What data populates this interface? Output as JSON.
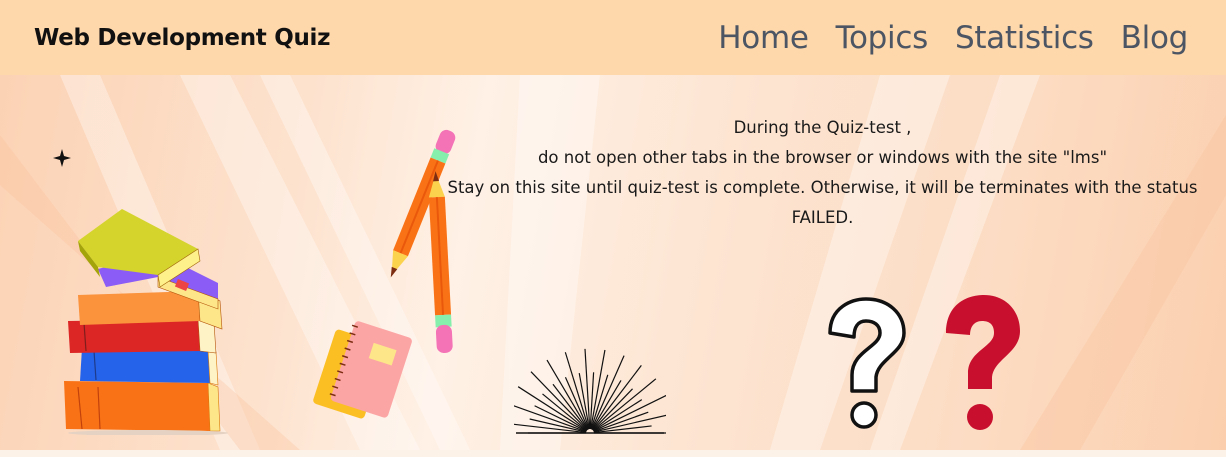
{
  "navbar": {
    "brand": "Web Development Quiz",
    "links": [
      {
        "label": "Home"
      },
      {
        "label": "Topics"
      },
      {
        "label": "Statistics"
      },
      {
        "label": "Blog"
      }
    ]
  },
  "notice": {
    "line1": "During the Quiz-test ,",
    "line2": "do not open other tabs in the browser or windows with the site \"lms\"",
    "line3": "Stay on this site until quiz-test is complete. Otherwise, it will be terminates with the status FAILED."
  },
  "colors": {
    "navbar_bg": "#fed7aa",
    "nav_link": "#4b5563",
    "brand": "#111111",
    "question_mark_red": "#c8102e"
  },
  "illustrations": [
    "books-stack",
    "pencils",
    "notebooks",
    "sunburst",
    "question-mark-outline",
    "question-mark-red",
    "sparkle"
  ]
}
